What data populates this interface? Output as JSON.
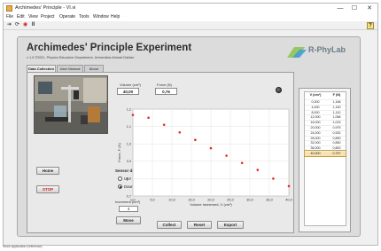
{
  "window": {
    "title": "Archimedes' Principle - VI.vi",
    "controls": [
      "—",
      "☐",
      "✕"
    ]
  },
  "menu": [
    "File",
    "Edit",
    "View",
    "Project",
    "Operate",
    "Tools",
    "Window",
    "Help"
  ],
  "toolbar": {
    "run_icon": "➔",
    "run_cont_icon": "⟳",
    "abort_icon": "◉",
    "pause_icon": "II",
    "help": "?"
  },
  "header": {
    "title": "Archimedes' Principle Experiment",
    "subtitle": "v 1.0 ©2021, Physics Education Department, Universitas Ahmad Dahlan",
    "logo": "R-PhyLab"
  },
  "tabs": [
    "Data Collection",
    "User Manual",
    "About"
  ],
  "readouts": {
    "volume_label": "Volume (cm³)",
    "volume_value": "40,00",
    "force_label": "Force (N)",
    "force_value": "0,76"
  },
  "buttons": {
    "home": "Home",
    "stop": "STOP",
    "move": "Move",
    "collect": "Collect",
    "reset": "Reset",
    "export": "Export"
  },
  "sensor": {
    "title": "Sensor direction",
    "up": "Up",
    "down": "Down",
    "selected": "Down",
    "increment_label": "Increment (cm³)",
    "increment_value": "4"
  },
  "chart_data": {
    "type": "scatter",
    "xlabel": "Volume Immersed, V (cm³)",
    "ylabel": "Force, F (N)",
    "xlim": [
      0,
      40
    ],
    "ylim": [
      0.7,
      1.2
    ],
    "xticks": [
      "0,0",
      "5,0",
      "10,0",
      "15,0",
      "20,0",
      "25,0",
      "30,0",
      "35,0",
      "40,0"
    ],
    "yticks": [
      "0,7",
      "0,8",
      "0,9",
      "1,0",
      "1,1",
      "1,2"
    ],
    "grid": true,
    "point_color": "#e8262a",
    "x": [
      0,
      4,
      8,
      12,
      16,
      20,
      24,
      28,
      32,
      36,
      40
    ],
    "y": [
      1.166,
      1.15,
      1.11,
      1.066,
      1.023,
      0.975,
      0.932,
      0.89,
      0.85,
      0.8,
      0.757
    ]
  },
  "table": {
    "headers": [
      "V (cm³)",
      "F (N)"
    ],
    "rows": [
      [
        "0,000",
        "1,166"
      ],
      [
        "4,000",
        "1,150"
      ],
      [
        "8,000",
        "1,110"
      ],
      [
        "12,000",
        "1,066"
      ],
      [
        "16,000",
        "1,023"
      ],
      [
        "20,000",
        "0,975"
      ],
      [
        "24,000",
        "0,932"
      ],
      [
        "28,000",
        "0,890"
      ],
      [
        "32,000",
        "0,850"
      ],
      [
        "36,000",
        "0,800"
      ],
      [
        "40,000",
        "0,757"
      ]
    ],
    "highlight_row": 10
  },
  "status": "Show application (reference)"
}
